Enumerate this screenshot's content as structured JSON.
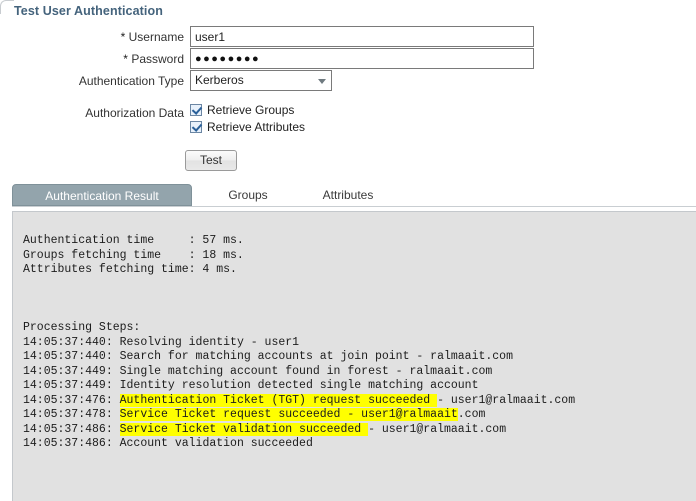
{
  "page": {
    "title": "Test User Authentication"
  },
  "form": {
    "username": {
      "label_star": "*",
      "label": "Username",
      "value": "user1",
      "placeholder": ""
    },
    "password": {
      "label_star": "*",
      "label": "Password",
      "value": "●●●●●●●●",
      "placeholder": ""
    },
    "auth_type": {
      "label": "Authentication Type",
      "selected": "Kerberos",
      "options": [
        "Kerberos"
      ]
    },
    "authorization_data": {
      "label": "Authorization Data",
      "checkboxes": [
        {
          "label": "Retrieve Groups",
          "checked": true
        },
        {
          "label": "Retrieve Attributes",
          "checked": true
        }
      ]
    },
    "test_button": {
      "label": "Test"
    }
  },
  "tabs": [
    {
      "label": "Authentication Result",
      "active": true
    },
    {
      "label": "Groups",
      "active": false
    },
    {
      "label": "Attributes",
      "active": false
    }
  ],
  "log": {
    "summary": [
      "Authentication time     : 57 ms.",
      "Groups fetching time    : 18 ms.",
      "Attributes fetching time: 4 ms."
    ],
    "steps_header": "Processing Steps:",
    "steps": [
      {
        "time": "14:05:37:440: ",
        "highlighted": "",
        "rest": "Resolving identity - user1"
      },
      {
        "time": "14:05:37:440: ",
        "highlighted": "",
        "rest": "Search for matching accounts at join point - ralmaait.com"
      },
      {
        "time": "14:05:37:449: ",
        "highlighted": "",
        "rest": "Single matching account found in forest - ralmaait.com"
      },
      {
        "time": "14:05:37:449: ",
        "highlighted": "",
        "rest": "Identity resolution detected single matching account"
      },
      {
        "time": "14:05:37:476: ",
        "highlighted": "Authentication Ticket (TGT) request succeeded ",
        "rest": "- user1@ralmaait.com"
      },
      {
        "time": "14:05:37:478: ",
        "highlighted": "Service Ticket request succeeded - user1@ralmaait",
        "rest": ".com"
      },
      {
        "time": "14:05:37:486: ",
        "highlighted": "Service Ticket validation succeeded ",
        "rest": "- user1@ralmaait.com"
      },
      {
        "time": "14:05:37:486: ",
        "highlighted": "",
        "rest": "Account validation succeeded"
      }
    ]
  },
  "colors": {
    "title": "#44637c",
    "tab_active_bg": "#93a4ac",
    "highlight": "#ffff00",
    "panel_bg": "#e1e1e1"
  }
}
